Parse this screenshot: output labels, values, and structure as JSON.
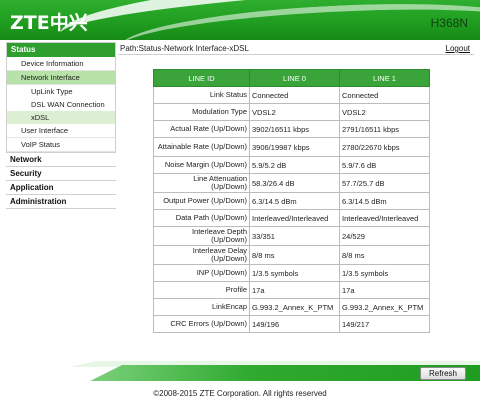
{
  "header": {
    "logo": "ZTE中兴",
    "model": "H368N"
  },
  "nav": {
    "status": "Status",
    "device_information": "Device Information",
    "network_interface": "Network Interface",
    "uplink_type": "UpLink Type",
    "dsl_wan_connection": "DSL WAN Connection",
    "xdsl": "xDSL",
    "user_interface": "User Interface",
    "voip_status": "VoIP Status",
    "network": "Network",
    "security": "Security",
    "application": "Application",
    "administration": "Administration"
  },
  "pathbar": {
    "path": "Path:Status-Network Interface-xDSL",
    "logout": "Logout"
  },
  "table": {
    "headers": [
      "LINE ID",
      "LINE 0",
      "LINE 1"
    ],
    "rows": [
      {
        "label": "Link Status",
        "line0": "Connected",
        "line1": "Connected"
      },
      {
        "label": "Modulation Type",
        "line0": "VDSL2",
        "line1": "VDSL2"
      },
      {
        "label": "Actual Rate (Up/Down)",
        "line0": "3902/16511 kbps",
        "line1": "2791/16511 kbps"
      },
      {
        "label": "Attainable Rate (Up/Down)",
        "line0": "3906/19987 kbps",
        "line1": "2780/22670 kbps"
      },
      {
        "label": "Noise Margin (Up/Down)",
        "line0": "5.9/5.2 dB",
        "line1": "5.9/7.6 dB"
      },
      {
        "label": "Line Attenuation (Up/Down)",
        "line0": "58.3/26.4 dB",
        "line1": "57.7/25.7 dB"
      },
      {
        "label": "Output Power (Up/Down)",
        "line0": "6.3/14.5 dBm",
        "line1": "6.3/14.5 dBm"
      },
      {
        "label": "Data Path (Up/Down)",
        "line0": "Interleaved/Interleaved",
        "line1": "Interleaved/Interleaved"
      },
      {
        "label": "Interleave Depth (Up/Down)",
        "line0": "33/351",
        "line1": "24/529"
      },
      {
        "label": "Interleave Delay (Up/Down)",
        "line0": "8/8 ms",
        "line1": "8/8 ms"
      },
      {
        "label": "INP (Up/Down)",
        "line0": "1/3.5 symbols",
        "line1": "1/3.5 symbols"
      },
      {
        "label": "Profile",
        "line0": "17a",
        "line1": "17a"
      },
      {
        "label": "LinkEncap",
        "line0": "G.993.2_Annex_K_PTM",
        "line1": "G.993.2_Annex_K_PTM"
      },
      {
        "label": "CRC Errors (Up/Down)",
        "line0": "149/196",
        "line1": "149/217"
      }
    ]
  },
  "footer": {
    "refresh": "Refresh",
    "copyright": "©2008-2015 ZTE Corporation. All rights reserved"
  },
  "colors": {
    "brand_green": "#2e9e2e",
    "header_green": "#1f9c1f",
    "nav_active": "#b8e3a8"
  }
}
